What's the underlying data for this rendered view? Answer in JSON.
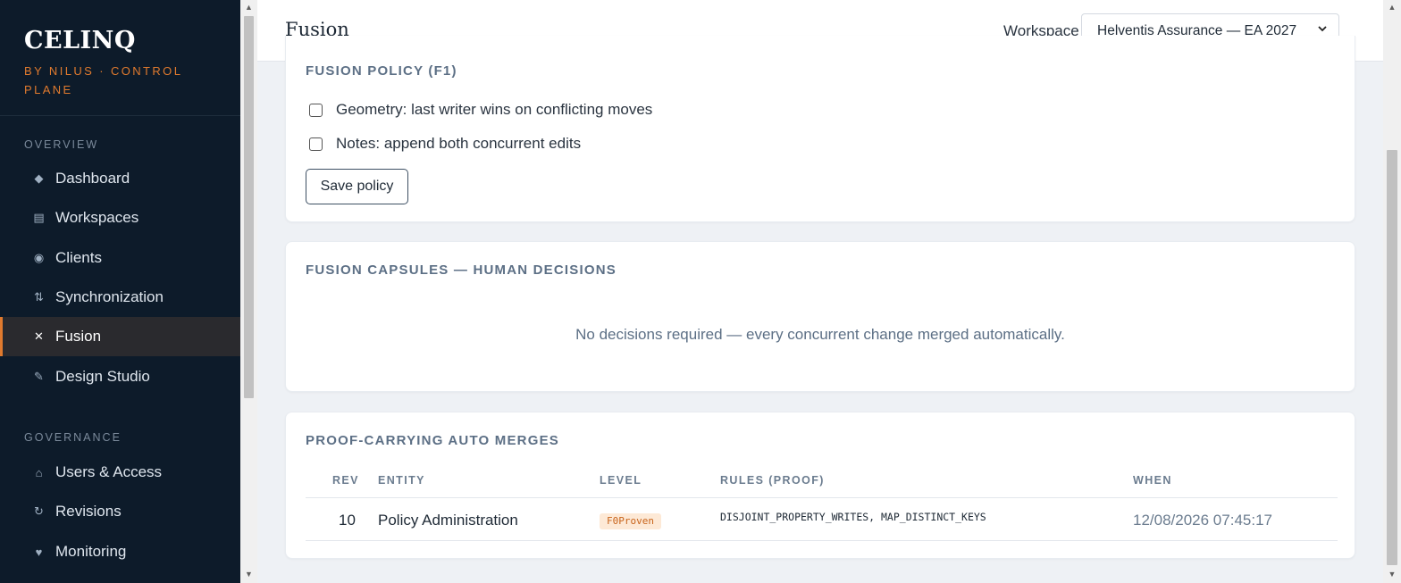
{
  "sidebar": {
    "brand": "CELINQ",
    "tagline": "BY NILUS · CONTROL PLANE",
    "sections": [
      {
        "label": "OVERVIEW",
        "items": [
          {
            "label": "Dashboard",
            "icon": "◆"
          },
          {
            "label": "Workspaces",
            "icon": "▤"
          },
          {
            "label": "Clients",
            "icon": "◉"
          },
          {
            "label": "Synchronization",
            "icon": "⇅"
          },
          {
            "label": "Fusion",
            "icon": "✕",
            "active": true
          },
          {
            "label": "Design Studio",
            "icon": "✎"
          }
        ]
      },
      {
        "label": "GOVERNANCE",
        "items": [
          {
            "label": "Users & Access",
            "icon": "⌂"
          },
          {
            "label": "Revisions",
            "icon": "↻"
          },
          {
            "label": "Monitoring",
            "icon": "♥"
          }
        ]
      }
    ]
  },
  "header": {
    "title": "Fusion",
    "workspace_label": "Workspace",
    "workspace_value": "Helventis Assurance — EA 2027"
  },
  "policy": {
    "title": "FUSION POLICY (F1)",
    "options": [
      {
        "label": "Geometry: last writer wins on conflicting moves",
        "checked": false
      },
      {
        "label": "Notes: append both concurrent edits",
        "checked": false
      }
    ],
    "save_label": "Save policy"
  },
  "capsules": {
    "title": "FUSION CAPSULES — HUMAN DECISIONS",
    "empty_message": "No decisions required — every concurrent change merged automatically."
  },
  "merges": {
    "title": "PROOF-CARRYING AUTO MERGES",
    "columns": [
      "REV",
      "ENTITY",
      "LEVEL",
      "RULES (PROOF)",
      "WHEN"
    ],
    "rows": [
      {
        "rev": "10",
        "entity": "Policy Administration",
        "level": "F0Proven",
        "rules": "DISJOINT_PROPERTY_WRITES, MAP_DISTINCT_KEYS",
        "when": "12/08/2026 07:45:17"
      }
    ]
  },
  "colors": {
    "sidebar_bg": "#0d1b2a",
    "accent": "#e07a2e",
    "badge_bg": "#fde9d6"
  }
}
